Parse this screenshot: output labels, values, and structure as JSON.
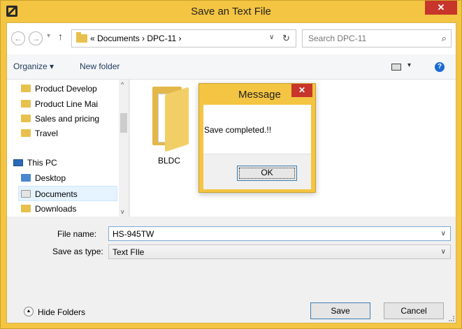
{
  "window": {
    "title": "Save an Text File",
    "close_glyph": "✕"
  },
  "address": {
    "back_glyph": "←",
    "forward_glyph": "→",
    "recent_glyph": "▾",
    "up_glyph": "↑",
    "path": "«  Documents  ›  DPC-11  ›",
    "dropdown_glyph": "∨",
    "refresh_glyph": "↻"
  },
  "search": {
    "placeholder": "Search DPC-11",
    "icon_glyph": "⌕"
  },
  "toolbar": {
    "organize": "Organize ▾",
    "new_folder": "New folder",
    "view_drop": "▾",
    "help": "?"
  },
  "nav": {
    "items": [
      "Product Develop",
      "Product Line Mai",
      "Sales and pricing",
      "Travel",
      "This PC",
      "Desktop",
      "Documents",
      "Downloads"
    ],
    "scroll_up": "^",
    "scroll_down": "v"
  },
  "content": {
    "folder_label": "BLDC"
  },
  "message": {
    "title": "Message",
    "close_glyph": "✕",
    "text": "Save completed.!!",
    "ok": "OK"
  },
  "form": {
    "file_name_label": "File name:",
    "file_name_value": "HS-945TW",
    "save_type_label": "Save as type:",
    "save_type_value": "Text FIle",
    "dropdown_glyph": "∨"
  },
  "footer": {
    "hide_folders": "Hide Folders",
    "hide_glyph": "▲",
    "save": "Save",
    "cancel": "Cancel"
  }
}
